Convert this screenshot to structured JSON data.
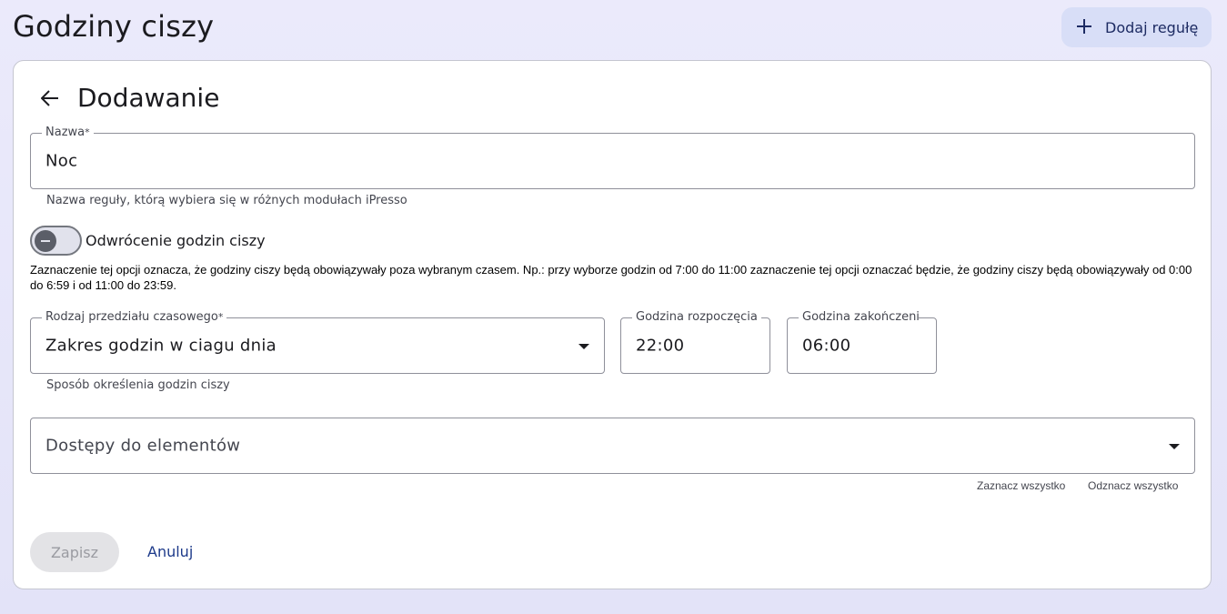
{
  "header": {
    "title": "Godziny ciszy",
    "add_rule_label": "Dodaj regułę"
  },
  "form": {
    "title": "Dodawanie",
    "name": {
      "label": "Nazwa",
      "required_mark": "*",
      "value": "Noc",
      "helper": "Nazwa reguły, którą wybiera się w różnych modułach iPresso"
    },
    "invert_toggle": {
      "label": "Odwrócenie godzin ciszy",
      "checked": false,
      "description": "Zaznaczenie tej opcji oznacza, że godziny ciszy będą obowiązywały poza wybranym czasem. Np.: przy wyborze godzin od 7:00 do 11:00 zaznaczenie tej opcji oznaczać będzie, że godziny ciszy będą obowiązywały od 0:00 do 6:59 i od 11:00 do 23:59."
    },
    "interval_type": {
      "label": "Rodzaj przedziału czasowego",
      "required_mark": "*",
      "value": "Zakres godzin w ciagu dnia",
      "helper": "Sposób określenia godzin ciszy"
    },
    "start_time": {
      "label": "Godzina rozpoczęcia",
      "value": "22:00"
    },
    "end_time": {
      "label": "Godzina zakończenia",
      "value": "06:00"
    },
    "access": {
      "placeholder": "Dostępy do elementów",
      "select_all": "Zaznacz wszystko",
      "deselect_all": "Odznacz wszystko"
    },
    "actions": {
      "save_label": "Zapisz",
      "cancel_label": "Anuluj"
    }
  },
  "icons": {
    "add": "plus-icon",
    "back": "arrow-left-icon",
    "dropdown": "triangle-down-icon",
    "toggle_off": "minus-icon"
  },
  "colors": {
    "accent": "#1d2b63",
    "add_button_bg": "#d8def7",
    "link": "#1d3a8a"
  }
}
